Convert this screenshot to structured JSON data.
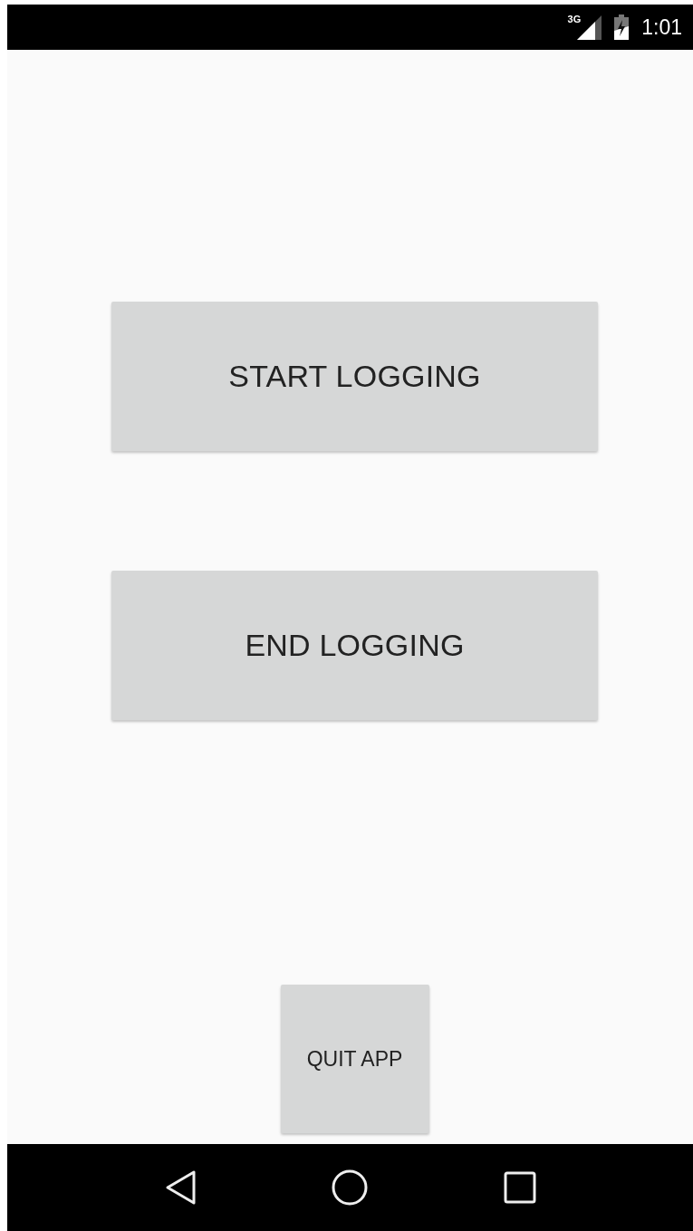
{
  "status_bar": {
    "network": "3G",
    "time": "1:01"
  },
  "buttons": [
    {
      "label": "START LOGGING"
    },
    {
      "label": "END LOGGING"
    }
  ],
  "quit_button": {
    "label": "QUIT APP"
  }
}
